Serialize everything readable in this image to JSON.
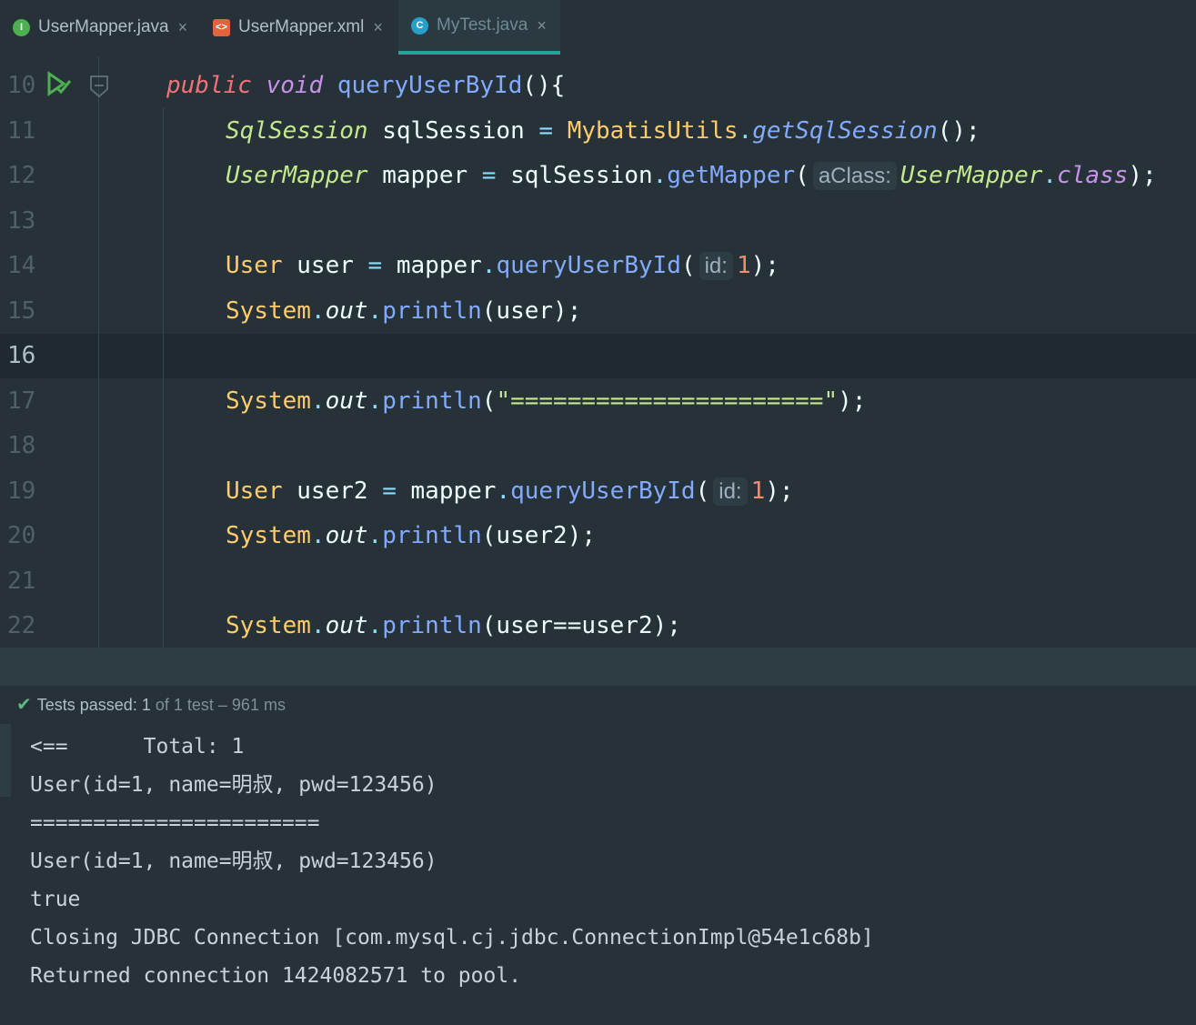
{
  "tabs": [
    {
      "label": "UserMapper.java",
      "icon": "interface-java-icon",
      "color": "#4caf50"
    },
    {
      "label": "UserMapper.xml",
      "icon": "xml-file-icon",
      "color": "#e0643c"
    },
    {
      "label": "MyTest.java",
      "icon": "class-java-icon",
      "color": "#26a0c8",
      "active": true
    }
  ],
  "tab_close": "×",
  "code_lines": [
    {
      "num": "10",
      "tokens": [
        [
          "kw",
          "public"
        ],
        [
          "",
          " "
        ],
        [
          "kw2",
          "void"
        ],
        [
          "",
          " "
        ],
        [
          "fn",
          "queryUserById"
        ],
        [
          "",
          "(){"
        ]
      ]
    },
    {
      "num": "11",
      "tokens": [
        [
          "ty",
          "SqlSession"
        ],
        [
          "",
          " sqlSession "
        ],
        [
          "pun",
          "="
        ],
        [
          "",
          " "
        ],
        [
          "cls",
          "MybatisUtils"
        ],
        [
          "pun",
          "."
        ],
        [
          "fn it",
          "getSqlSession"
        ],
        [
          "",
          "();"
        ]
      ]
    },
    {
      "num": "12",
      "tokens": [
        [
          "ty",
          "UserMapper"
        ],
        [
          "",
          " mapper "
        ],
        [
          "pun",
          "="
        ],
        [
          "",
          " sqlSession"
        ],
        [
          "pun",
          "."
        ],
        [
          "fn",
          "getMapper"
        ],
        [
          "",
          "("
        ],
        [
          "hint",
          "aClass:"
        ],
        [
          "ty",
          "UserMapper"
        ],
        [
          "pun",
          "."
        ],
        [
          "kw2",
          "class"
        ],
        [
          "",
          ");"
        ]
      ]
    },
    {
      "num": "13",
      "tokens": []
    },
    {
      "num": "14",
      "tokens": [
        [
          "cls",
          "User"
        ],
        [
          "",
          " user "
        ],
        [
          "pun",
          "="
        ],
        [
          "",
          " mapper"
        ],
        [
          "pun",
          "."
        ],
        [
          "fn",
          "queryUserById"
        ],
        [
          "",
          "("
        ],
        [
          "hint",
          "id:"
        ],
        [
          "num",
          "1"
        ],
        [
          "",
          ");"
        ]
      ]
    },
    {
      "num": "15",
      "tokens": [
        [
          "cls",
          "System"
        ],
        [
          "pun",
          "."
        ],
        [
          "it",
          "out"
        ],
        [
          "pun",
          "."
        ],
        [
          "fn",
          "println"
        ],
        [
          "",
          "(user);"
        ]
      ]
    },
    {
      "num": "16",
      "tokens": [],
      "current": true
    },
    {
      "num": "17",
      "tokens": [
        [
          "cls",
          "System"
        ],
        [
          "pun",
          "."
        ],
        [
          "it",
          "out"
        ],
        [
          "pun",
          "."
        ],
        [
          "fn",
          "println"
        ],
        [
          "",
          "("
        ],
        [
          "str",
          "\"======================\""
        ],
        [
          "",
          ");"
        ]
      ]
    },
    {
      "num": "18",
      "tokens": []
    },
    {
      "num": "19",
      "tokens": [
        [
          "cls",
          "User"
        ],
        [
          "",
          " user2 "
        ],
        [
          "pun",
          "="
        ],
        [
          "",
          " mapper"
        ],
        [
          "pun",
          "."
        ],
        [
          "fn",
          "queryUserById"
        ],
        [
          "",
          "("
        ],
        [
          "hint",
          "id:"
        ],
        [
          "num",
          "1"
        ],
        [
          "",
          ");"
        ]
      ]
    },
    {
      "num": "20",
      "tokens": [
        [
          "cls",
          "System"
        ],
        [
          "pun",
          "."
        ],
        [
          "it",
          "out"
        ],
        [
          "pun",
          "."
        ],
        [
          "fn",
          "println"
        ],
        [
          "",
          "(user2);"
        ]
      ]
    },
    {
      "num": "21",
      "tokens": []
    },
    {
      "num": "22",
      "tokens": [
        [
          "cls",
          "System"
        ],
        [
          "pun",
          "."
        ],
        [
          "it",
          "out"
        ],
        [
          "pun",
          "."
        ],
        [
          "fn",
          "println"
        ],
        [
          "",
          "(user==user2);"
        ]
      ]
    }
  ],
  "status": {
    "passed_label": "Tests passed:",
    "passed_count": "1",
    "detail": "of 1 test – 961 ms"
  },
  "console_lines": [
    "<==      Total: 1",
    "User(id=1, name=明叔, pwd=123456)",
    "=======================",
    "User(id=1, name=明叔, pwd=123456)",
    "true",
    "Closing JDBC Connection [com.mysql.cj.jdbc.ConnectionImpl@54e1c68b]",
    "Returned connection 1424082571 to pool."
  ]
}
